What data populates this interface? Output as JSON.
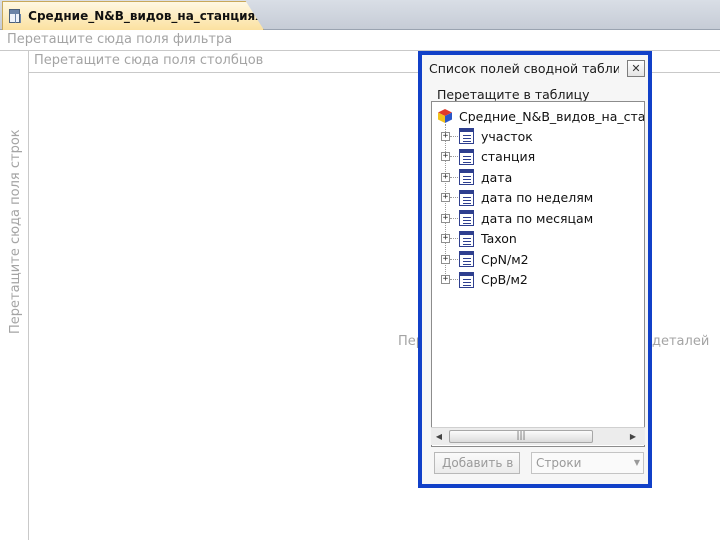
{
  "document_tab": {
    "title": "Средние_N&B_видов_на_станциях"
  },
  "drop_zones": {
    "filter": "Перетащите сюда поля фильтра",
    "columns": "Перетащите сюда поля столбцов",
    "rows": "Перетащите сюда поля строк",
    "details_left": "Пер",
    "details_right": "деталей"
  },
  "field_list": {
    "title": "Список полей сводной табли",
    "close_symbol": "✕",
    "hint": "Перетащите в таблицу",
    "root": "Средние_N&B_видов_на_станц",
    "items": [
      {
        "label": "участок"
      },
      {
        "label": "станция"
      },
      {
        "label": "дата"
      },
      {
        "label": "дата по неделям"
      },
      {
        "label": "дата по месяцам"
      },
      {
        "label": "Taxon"
      },
      {
        "label": "CpN/м2"
      },
      {
        "label": "CpB/м2"
      }
    ],
    "expander_symbol": "+",
    "scroll_left": "◀",
    "scroll_right": "▶",
    "scroll_grip": "|||",
    "add_button": "Добавить в",
    "area_select": {
      "value": "Строки",
      "dropdown_symbol": "▼"
    }
  },
  "colors": {
    "frame_blue": "#1140c8",
    "tab_fill": "#fbe1a0",
    "hint_gray": "#a4a4a4"
  },
  "icons": {
    "tab": "table-icon",
    "root": "cube-icon",
    "field": "field-icon"
  }
}
